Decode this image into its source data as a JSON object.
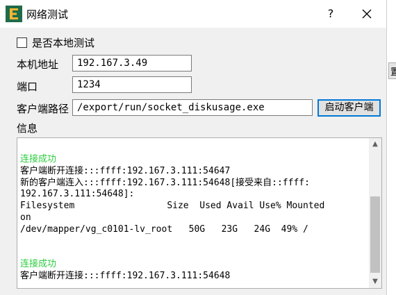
{
  "window": {
    "title": "网络测试"
  },
  "titlebar": {
    "help_label": "?"
  },
  "local_test": {
    "label": "是否本地测试",
    "checked": false
  },
  "host": {
    "label": "本机地址",
    "value": "192.167.3.49"
  },
  "port": {
    "label": "端口",
    "value": "1234"
  },
  "client_path": {
    "label": "客户端路径",
    "value": "/export/run/socket_diskusage.exe",
    "button_label": "启动客户端"
  },
  "info": {
    "label": "信息",
    "lines": [
      {
        "text": "连接成功",
        "kind": "ok"
      },
      {
        "text": "客户端断开连接:::ffff:192.167.3.111:54647",
        "kind": "normal"
      },
      {
        "text": "新的客户端连入:::ffff:192.167.3.111:54648[接受来自::ffff:",
        "kind": "normal"
      },
      {
        "text": "192.167.3.111:54648]:",
        "kind": "normal"
      },
      {
        "text": "Filesystem                 Size  Used Avail Use% Mounted",
        "kind": "normal"
      },
      {
        "text": "on",
        "kind": "normal"
      },
      {
        "text": "/dev/mapper/vg_c0101-lv_root   50G   23G   24G  49% /",
        "kind": "normal"
      },
      {
        "text": "",
        "kind": "normal"
      },
      {
        "text": "",
        "kind": "normal"
      },
      {
        "text": "连接成功",
        "kind": "ok"
      },
      {
        "text": "客户端断开连接:::ffff:192.167.3.111:54648",
        "kind": "normal"
      }
    ]
  },
  "background_window": {
    "button_fragment": "置"
  },
  "colors": {
    "success_text": "#2ecc40",
    "focus_border": "#0078d7"
  }
}
